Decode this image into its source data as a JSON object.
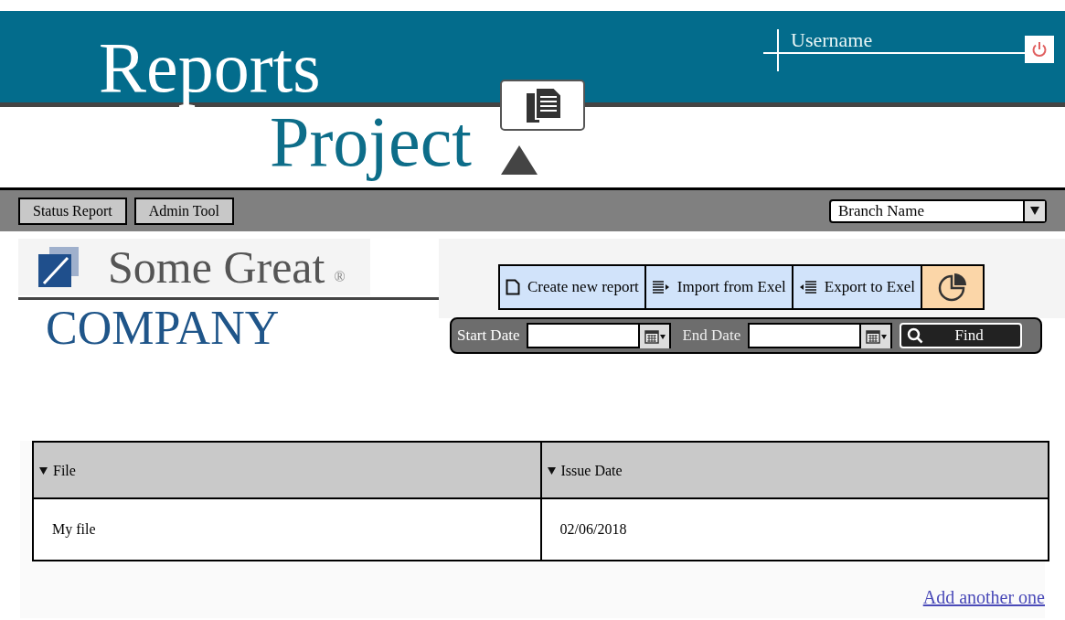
{
  "header": {
    "title_line1": "Reports",
    "title_line2": "Project",
    "username": "Username"
  },
  "nav": {
    "buttons": [
      {
        "label": "Status Report"
      },
      {
        "label": "Admin Tool"
      }
    ],
    "branch_select": {
      "value": "Branch Name"
    }
  },
  "company": {
    "name_line1": "Some Great",
    "registered": "®",
    "name_line2": "COMPANY"
  },
  "toolbar": {
    "buttons": [
      {
        "kind": "new",
        "label": "Create new report"
      },
      {
        "kind": "import",
        "label": "Import from Exel"
      },
      {
        "kind": "export",
        "label": "Export to Exel"
      },
      {
        "kind": "chart"
      }
    ]
  },
  "filters": {
    "start_label": "Start Date",
    "end_label": "End Date",
    "find": "Find"
  },
  "table": {
    "columns": [
      "File",
      "Issue Date"
    ],
    "rows": [
      [
        "My file",
        "02/06/2018"
      ]
    ]
  },
  "add_link": "Add another one"
}
